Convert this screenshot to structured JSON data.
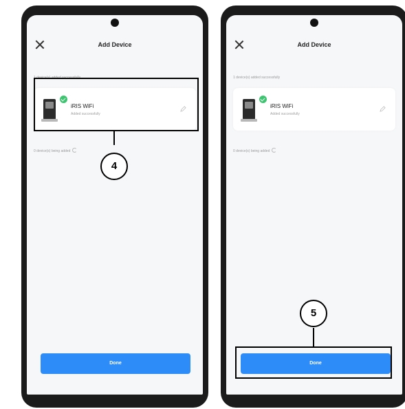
{
  "screens": [
    {
      "title": "Add Device",
      "added_label": "1 device(s) added successfully",
      "adding_label": "0 device(s) being added",
      "device": {
        "name": "iRIS WiFi",
        "status": "Added successfully"
      },
      "done_label": "Done"
    },
    {
      "title": "Add Device",
      "added_label": "1 device(s) added successfully",
      "adding_label": "0 device(s) being added",
      "device": {
        "name": "iRIS WiFi",
        "status": "Added successfully"
      },
      "done_label": "Done"
    }
  ],
  "callouts": [
    {
      "number": "4"
    },
    {
      "number": "5"
    }
  ],
  "colors": {
    "accent": "#2d8cf8",
    "success": "#3cc46f",
    "phone_frame": "#1b1b1b",
    "screen_bg": "#f6f7f9"
  },
  "icons": [
    "close-icon",
    "check-icon",
    "edit-icon",
    "spinner-icon"
  ]
}
